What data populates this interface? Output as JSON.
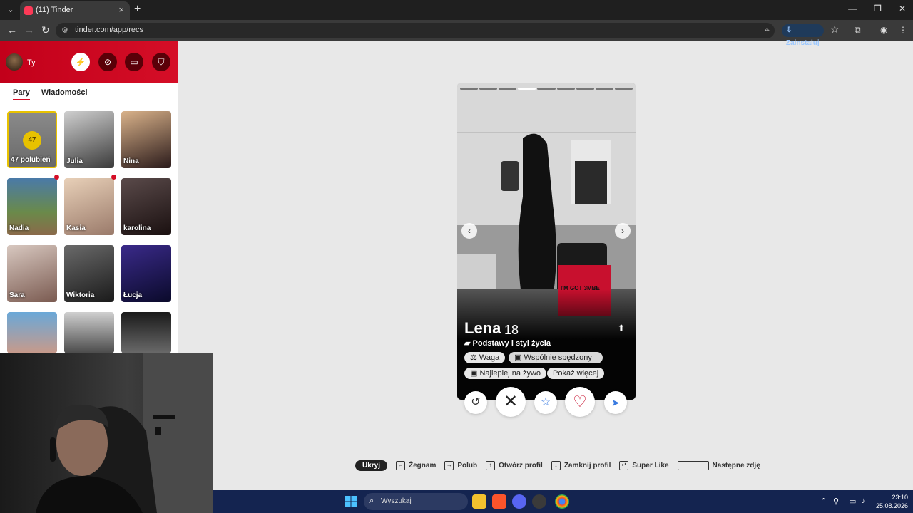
{
  "browser": {
    "tab_title": "(11) Tinder",
    "url": "tinder.com/app/recs",
    "install_label": "Zainstaluj"
  },
  "sidebar": {
    "user_name": "Ty",
    "tabs": [
      "Pary",
      "Wiadomości"
    ],
    "likes_count": "47",
    "likes_label": "47 polubień",
    "matches": [
      "Julia",
      "Nina",
      "Nadia",
      "Kasia",
      "karolina",
      "Sara",
      "Wiktoria",
      "Łucja"
    ]
  },
  "profile": {
    "name": "Lena",
    "age": "18",
    "basics_label": "Podstawy i styl życia",
    "chips": [
      "Waga",
      "Wspólnie spędzony",
      "Najlepiej na żywo",
      "Pokaż więcej"
    ],
    "album_text": "I'M GOT 3MBE"
  },
  "shortcuts": {
    "hide": "Ukryj",
    "items": [
      "Żegnam",
      "Polub",
      "Otwórz profil",
      "Zamknij profil",
      "Super Like",
      "Następne zdję"
    ]
  },
  "taskbar": {
    "search_placeholder": "Wyszukaj",
    "time": "23:10",
    "date": "25.08.2026"
  },
  "colors": {
    "brand": "#d50e27",
    "likes_gold": "#e8c200",
    "taskbar": "#142450"
  }
}
